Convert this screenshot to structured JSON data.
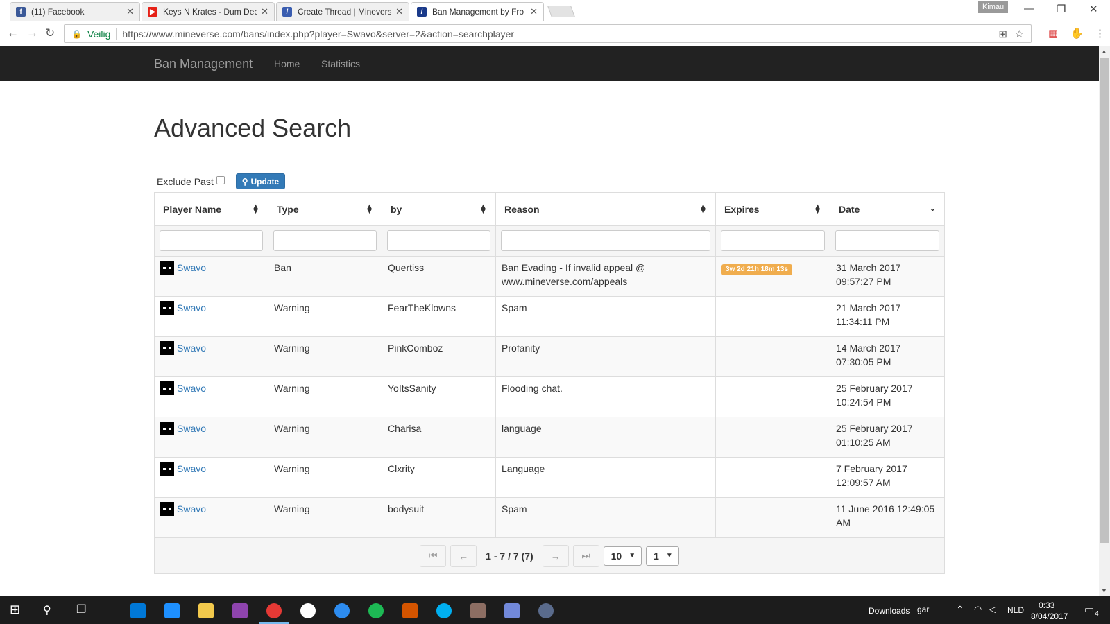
{
  "browser": {
    "tabs": [
      {
        "title": "(11) Facebook",
        "icon": "facebook-icon"
      },
      {
        "title": "Keys N Krates - Dum Dee",
        "icon": "youtube-icon"
      },
      {
        "title": "Create Thread | Minevers",
        "icon": "mineverse-icon"
      },
      {
        "title": "Ban Management by Fro",
        "icon": "mineverse-icon"
      }
    ],
    "profile_name": "Kimau",
    "secure_label": "Veilig",
    "url": "https://www.mineverse.com/bans/index.php?player=Swavo&server=2&action=searchplayer"
  },
  "site": {
    "brand": "Ban Management",
    "nav": [
      "Home",
      "Statistics"
    ]
  },
  "page": {
    "title": "Advanced Search",
    "exclude_label": "Exclude Past",
    "update_label": "Update"
  },
  "table": {
    "columns": [
      "Player Name",
      "Type",
      "by",
      "Reason",
      "Expires",
      "Date"
    ],
    "rows": [
      {
        "player": "Swavo",
        "type": "Ban",
        "by": "Quertiss",
        "reason": "Ban Evading - If invalid appeal @ www.mineverse.com/appeals",
        "expires": "3w 2d 21h 18m 13s",
        "date": "31 March 2017 09:57:27 PM"
      },
      {
        "player": "Swavo",
        "type": "Warning",
        "by": "FearTheKlowns",
        "reason": "Spam",
        "expires": "",
        "date": "21 March 2017 11:34:11 PM"
      },
      {
        "player": "Swavo",
        "type": "Warning",
        "by": "PinkComboz",
        "reason": "Profanity",
        "expires": "",
        "date": "14 March 2017 07:30:05 PM"
      },
      {
        "player": "Swavo",
        "type": "Warning",
        "by": "YoItsSanity",
        "reason": "Flooding chat.",
        "expires": "",
        "date": "25 February 2017 10:24:54 PM"
      },
      {
        "player": "Swavo",
        "type": "Warning",
        "by": "Charisa",
        "reason": "language",
        "expires": "",
        "date": "25 February 2017 01:10:25 AM"
      },
      {
        "player": "Swavo",
        "type": "Warning",
        "by": "Clxrity",
        "reason": "Language",
        "expires": "",
        "date": "7 February 2017 12:09:57 AM"
      },
      {
        "player": "Swavo",
        "type": "Warning",
        "by": "bodysuit",
        "reason": "Spam",
        "expires": "",
        "date": "11 June 2016 12:49:05 AM"
      }
    ],
    "pager": {
      "info": "1 - 7 / 7 (7)",
      "page_size": "10",
      "page": "1"
    }
  },
  "taskbar": {
    "downloads_label": "Downloads",
    "folder_label": "gar",
    "language": "NLD",
    "time": "0:33",
    "date": "8/04/2017",
    "notifications": "4"
  },
  "colors": {
    "navbar": "#222222",
    "link": "#337ab7",
    "badge": "#f0ad4e",
    "primary": "#337ab7"
  }
}
